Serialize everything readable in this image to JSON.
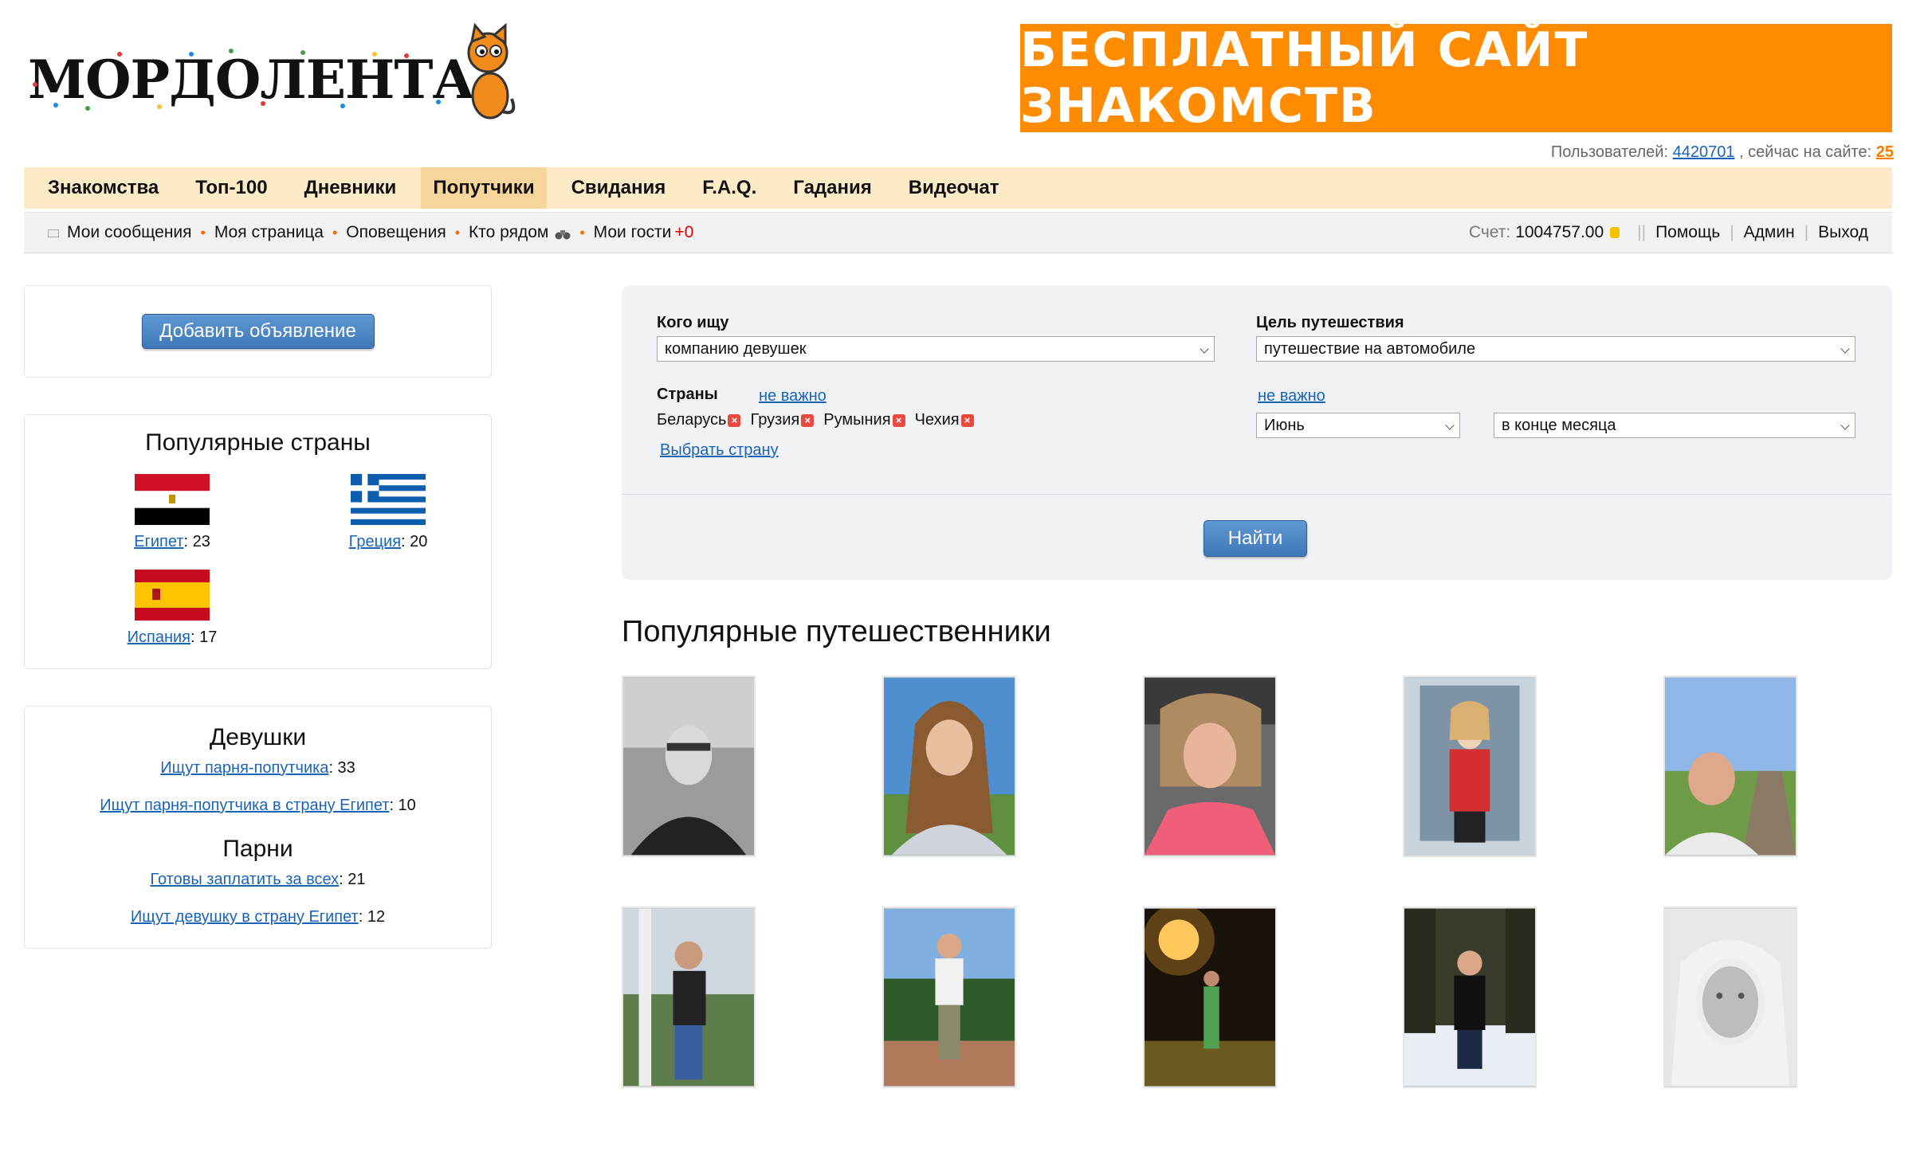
{
  "header": {
    "logo_text": "МОРДОЛЕНТА",
    "banner_text": "БЕСПЛАТНЫЙ САЙТ ЗНАКОМСТВ",
    "users_label": "Пользователей:",
    "users_count": "4420701",
    "online_label": ", сейчас на сайте:",
    "online_count": "25"
  },
  "main_nav": [
    {
      "label": "Знакомства",
      "active": false
    },
    {
      "label": "Топ-100",
      "active": false
    },
    {
      "label": "Дневники",
      "active": false
    },
    {
      "label": "Попутчики",
      "active": true
    },
    {
      "label": "Свидания",
      "active": false
    },
    {
      "label": "F.A.Q.",
      "active": false
    },
    {
      "label": "Гадания",
      "active": false
    },
    {
      "label": "Видеочат",
      "active": false
    }
  ],
  "sub_nav": {
    "messages": "Мои сообщения",
    "my_page": "Моя страница",
    "notifications": "Оповещения",
    "nearby": "Кто рядом",
    "guests": "Мои гости",
    "guests_new": "+0",
    "score_label": "Счет:",
    "score_value": "1004757.00",
    "help": "Помощь",
    "admin": "Админ",
    "logout": "Выход"
  },
  "sidebar": {
    "add_button": "Добавить объявление",
    "countries_title": "Популярные страны",
    "countries": [
      {
        "name": "Египет",
        "count": ": 23"
      },
      {
        "name": "Греция",
        "count": ": 20"
      },
      {
        "name": "Испания",
        "count": ": 17"
      }
    ],
    "girls_title": "Девушки",
    "girls_links": [
      {
        "label": "Ищут парня-попутчика",
        "count": ": 33"
      },
      {
        "label": "Ищут парня-попутчика в страну Египет",
        "count": ": 10"
      }
    ],
    "guys_title": "Парни",
    "guys_links": [
      {
        "label": "Готовы заплатить за всех",
        "count": ": 21"
      },
      {
        "label": "Ищут девушку в страну Египет",
        "count": ": 12"
      }
    ]
  },
  "search": {
    "who_label": "Кого ищу",
    "who_value": "компанию девушек",
    "goal_label": "Цель путешествия",
    "goal_value": "путешествие на автомобиле",
    "countries_label": "Страны",
    "countries_any": "не важно",
    "selected_countries": [
      "Беларусь",
      "Грузия",
      "Румыния",
      "Чехия"
    ],
    "choose_country": "Выбрать страну",
    "date_any": "не важно",
    "month_value": "Июнь",
    "period_value": "в конце месяца",
    "find_button": "Найти"
  },
  "travelers": {
    "title": "Популярные путешественники",
    "photos": [
      {
        "name": "traveler-photo-1"
      },
      {
        "name": "traveler-photo-2"
      },
      {
        "name": "traveler-photo-3"
      },
      {
        "name": "traveler-photo-4"
      },
      {
        "name": "traveler-photo-5"
      },
      {
        "name": "traveler-photo-6"
      },
      {
        "name": "traveler-photo-7"
      },
      {
        "name": "traveler-photo-8"
      },
      {
        "name": "traveler-photo-9"
      },
      {
        "name": "traveler-photo-10"
      }
    ]
  }
}
